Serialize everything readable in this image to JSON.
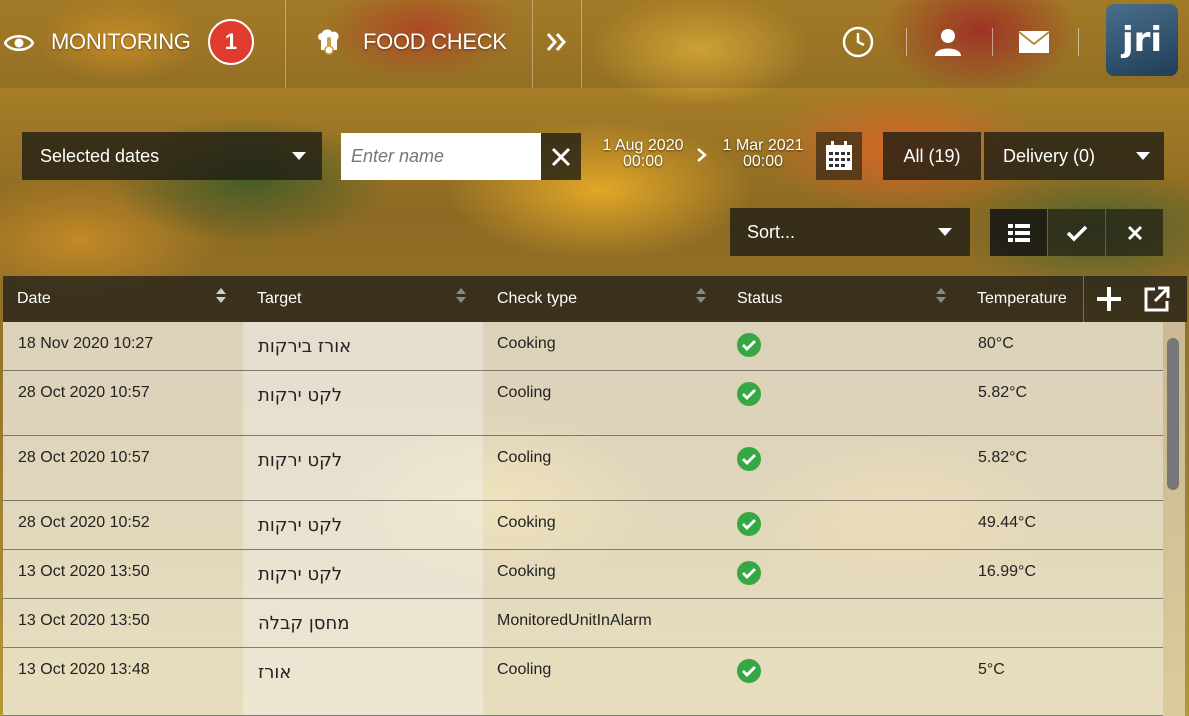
{
  "nav": {
    "monitoring_label": "MONITORING",
    "monitoring_badge": "1",
    "food_check_label": "FOOD CHECK",
    "logo_text": "jri"
  },
  "filters": {
    "date_range_select": "Selected dates",
    "name_placeholder": "Enter name",
    "start_date": "1 Aug 2020",
    "start_time": "00:00",
    "end_date": "1 Mar 2021",
    "end_time": "00:00",
    "tab_all": "All (19)",
    "tab_delivery": "Delivery (0)",
    "sort_placeholder": "Sort..."
  },
  "table": {
    "columns": [
      "Date",
      "Target",
      "Check type",
      "Status",
      "Temperature"
    ],
    "rows": [
      {
        "date": "18 Nov 2020 10:27",
        "target": "אורז בירקות",
        "check_type": "Cooking",
        "status": "ok",
        "temperature": "80°C"
      },
      {
        "date": "28 Oct 2020 10:57",
        "target": "לקט ירקות",
        "check_type": "Cooling",
        "status": "ok",
        "temperature": "5.82°C"
      },
      {
        "date": "28 Oct 2020 10:57",
        "target": "לקט ירקות",
        "check_type": "Cooling",
        "status": "ok",
        "temperature": "5.82°C"
      },
      {
        "date": "28 Oct 2020 10:52",
        "target": "לקט ירקות",
        "check_type": "Cooking",
        "status": "ok",
        "temperature": "49.44°C"
      },
      {
        "date": "13 Oct 2020 13:50",
        "target": "לקט ירקות",
        "check_type": "Cooking",
        "status": "ok",
        "temperature": "16.99°C"
      },
      {
        "date": "13 Oct 2020 13:50",
        "target": "מחסן קבלה",
        "check_type": "MonitoredUnitInAlarm",
        "status": "",
        "temperature": ""
      },
      {
        "date": "13 Oct 2020 13:48",
        "target": "אורז",
        "check_type": "Cooling",
        "status": "ok",
        "temperature": "5°C"
      }
    ]
  },
  "colors": {
    "badge": "#e13b2f",
    "status_ok": "#35a845"
  }
}
